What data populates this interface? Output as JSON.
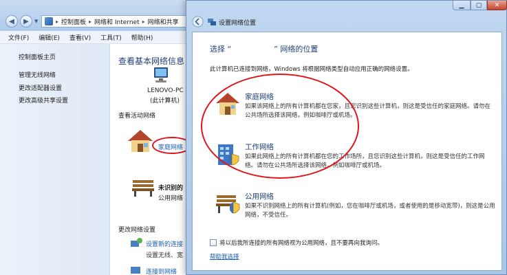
{
  "bg_window": {
    "address": {
      "crumbs": [
        "控制面板",
        "网络和 Internet",
        "网络和共享"
      ]
    },
    "menu": [
      "文件(F)",
      "编辑(E)",
      "查看(V)",
      "工具(T)",
      "帮助(H)"
    ],
    "sidebar": {
      "home": "控制面板主页",
      "links": [
        "管理无线网络",
        "更改适配器设置",
        "更改高级共享设置"
      ]
    },
    "main": {
      "title": "查看基本网络信息",
      "pc_name": "LENOVO-PC",
      "pc_sub": "(此计算机)",
      "active_networks_title": "查看活动网络",
      "home_network_link": "家庭网络",
      "unknown_network_title": "未识别的",
      "unknown_network_sub": "公用网络",
      "change_settings_title": "更改网络设置",
      "change_items": [
        {
          "link": "设置新的连接",
          "desc": "设置无线、宽"
        },
        {
          "link": "连接到网络"
        }
      ]
    }
  },
  "dialog": {
    "title": "设置网络位置",
    "heading_pre": "选择 “",
    "heading_post": "” 网络的位置",
    "intro": "此计算机已连接到网络，Windows 将根据网络类型自动应用正确的网络设置。",
    "options": [
      {
        "name": "家庭网络",
        "desc": "如果该网络上的所有计算机都在您家，且您识别这些计算机，则这是受信任的家庭网络。请勿在公共场所选择该网络，例如咖啡厅或机场。",
        "icon": "house-icon"
      },
      {
        "name": "工作网络",
        "desc": "如果此网络上的所有计算机都在您的工作场所，且您识别这些计算机，则这是受信任的工作网络。请勿在公共场所选择该网络，例如咖啡厅或机场。",
        "icon": "office-building-icon"
      },
      {
        "name": "公用网络",
        "desc": "如果不识别网络上的所有计算机(例如，您在咖啡厅或机场，或者使用的是移动宽带)，则这是公用网络，不受信任。",
        "icon": "park-bench-icon"
      }
    ],
    "checkbox_label": "将以后我所连接的所有网络视为公用网络，且不要再向我询问。",
    "help_link": "帮助我选择"
  },
  "colors": {
    "annotation": "#e0151c",
    "heading": "#1f3f76",
    "link": "#1a5fb4"
  }
}
